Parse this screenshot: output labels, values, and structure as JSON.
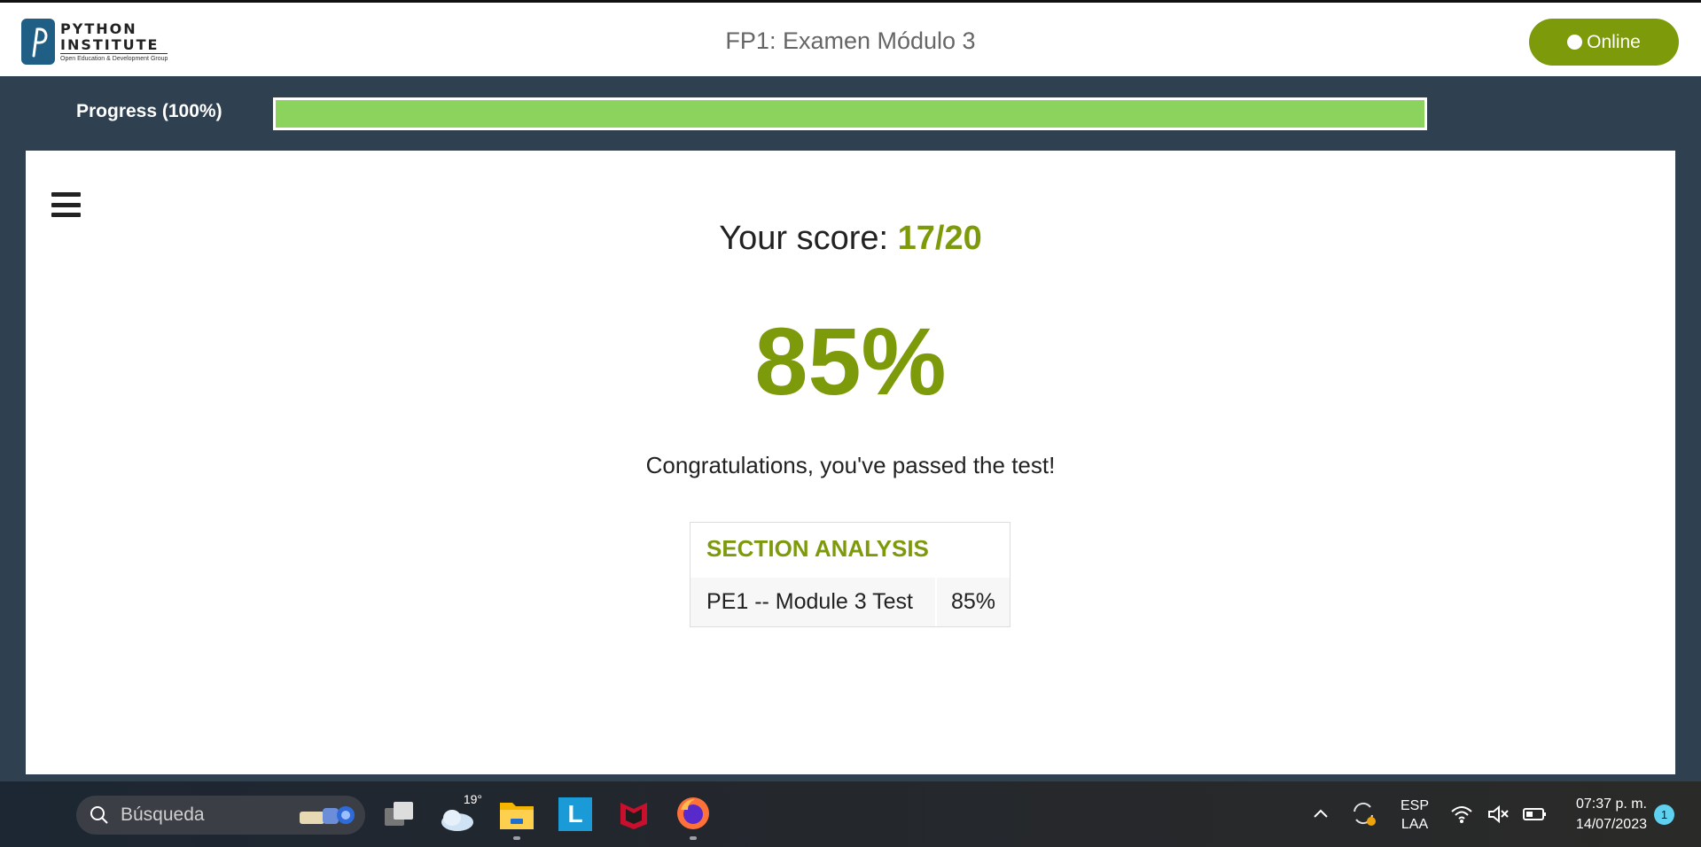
{
  "header": {
    "logo": {
      "line1": "PYTHON",
      "line2": "INSTITUTE",
      "tagline": "Open Education & Development Group"
    },
    "title": "FP1: Examen Módulo 3",
    "status_button": "Online"
  },
  "progress": {
    "label": "Progress (100%)",
    "value_percent": 100,
    "fill_color": "#8cd35d"
  },
  "result": {
    "score_label": "Your score: ",
    "score_value": "17/20",
    "percent": "85%",
    "message": "Congratulations, you've passed the test!",
    "accent_color": "#7d9a0a"
  },
  "section_analysis": {
    "title": "SECTION ANALYSIS",
    "rows": [
      {
        "name": "PE1 -- Module 3 Test",
        "value": "85%"
      }
    ]
  },
  "taskbar": {
    "search_placeholder": "Búsqueda",
    "weather_temp": "19°",
    "lapp_letter": "L",
    "language_line1": "ESP",
    "language_line2": "LAA",
    "time": "07:37 p. m.",
    "date": "14/07/2023",
    "notification_count": "1",
    "icons": [
      "windows-start-icon",
      "search-icon",
      "task-view-icon",
      "weather-icon",
      "file-explorer-icon",
      "l-app-icon",
      "mcafee-icon",
      "firefox-icon",
      "chevron-up-icon",
      "sync-icon",
      "wifi-icon",
      "speaker-muted-icon",
      "battery-icon"
    ]
  }
}
